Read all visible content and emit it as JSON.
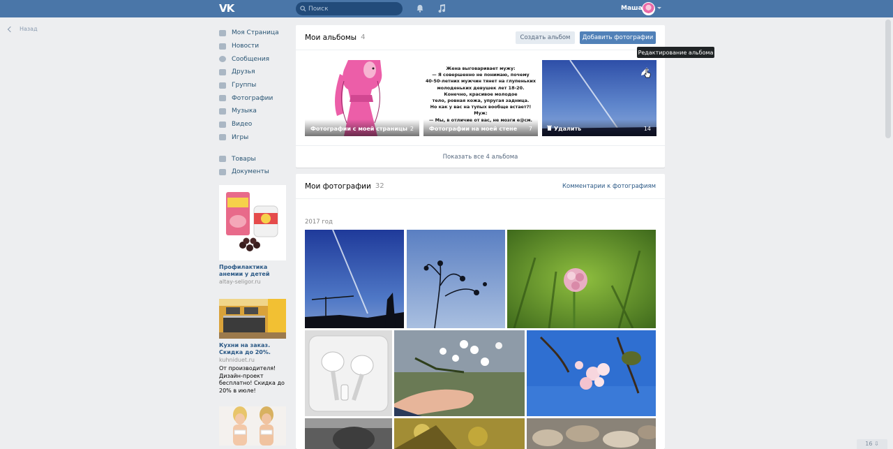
{
  "header": {
    "logo": "VK",
    "search_placeholder": "Поиск",
    "username": "Маша"
  },
  "back": {
    "label": "Назад"
  },
  "menu": {
    "items": [
      {
        "label": "Моя Страница",
        "icon": "home-icon"
      },
      {
        "label": "Новости",
        "icon": "news-icon"
      },
      {
        "label": "Сообщения",
        "icon": "messages-icon"
      },
      {
        "label": "Друзья",
        "icon": "friends-icon"
      },
      {
        "label": "Группы",
        "icon": "groups-icon"
      },
      {
        "label": "Фотографии",
        "icon": "camera-icon"
      },
      {
        "label": "Музыка",
        "icon": "music-icon"
      },
      {
        "label": "Видео",
        "icon": "video-icon"
      },
      {
        "label": "Игры",
        "icon": "games-icon"
      }
    ],
    "extra": [
      {
        "label": "Товары",
        "icon": "goods-icon"
      },
      {
        "label": "Документы",
        "icon": "documents-icon"
      }
    ]
  },
  "ads": [
    {
      "title": "Профилактика анемии у детей",
      "domain": "altay-seligor.ru",
      "desc": ""
    },
    {
      "title": "Кухни на заказ. Скидка до 20%.",
      "domain": "kuhniduet.ru",
      "desc": "От производителя! Дизайн-проект бесплатно! Скидка до 20% в июле!"
    }
  ],
  "albums": {
    "title": "Мои альбомы",
    "count": "4",
    "create_label": "Создать альбом",
    "add_label": "Добавить фотографии",
    "tooltip": "Редактирование альбома",
    "items": [
      {
        "name": "Фотографии с моей страницы",
        "count": "2"
      },
      {
        "name": "Фотографии на моей стене",
        "count": "7"
      },
      {
        "name": "Удалить",
        "count": "14"
      }
    ],
    "meme_text": "Жена выговаривает мужу:\n— Я совершенно не понимаю, почему\n40-50-летних мужчин тянет на глупеньких\nмолоденьких девушек лет 18-20.\nКонечно, красивое молодое\nтело, ровная кожа, упругая задница.\nНо как у вас на тупых вообще встает?!\nМуж:\n— Мы, в отличие от вас, не мозги е@см.",
    "show_all": "Показать все 4 альбома"
  },
  "photos": {
    "title": "Мои фотографии",
    "count": "32",
    "comments_link": "Комментарии к фотографиям",
    "year": "2017 год"
  },
  "page_badge": "16 ⇩"
}
